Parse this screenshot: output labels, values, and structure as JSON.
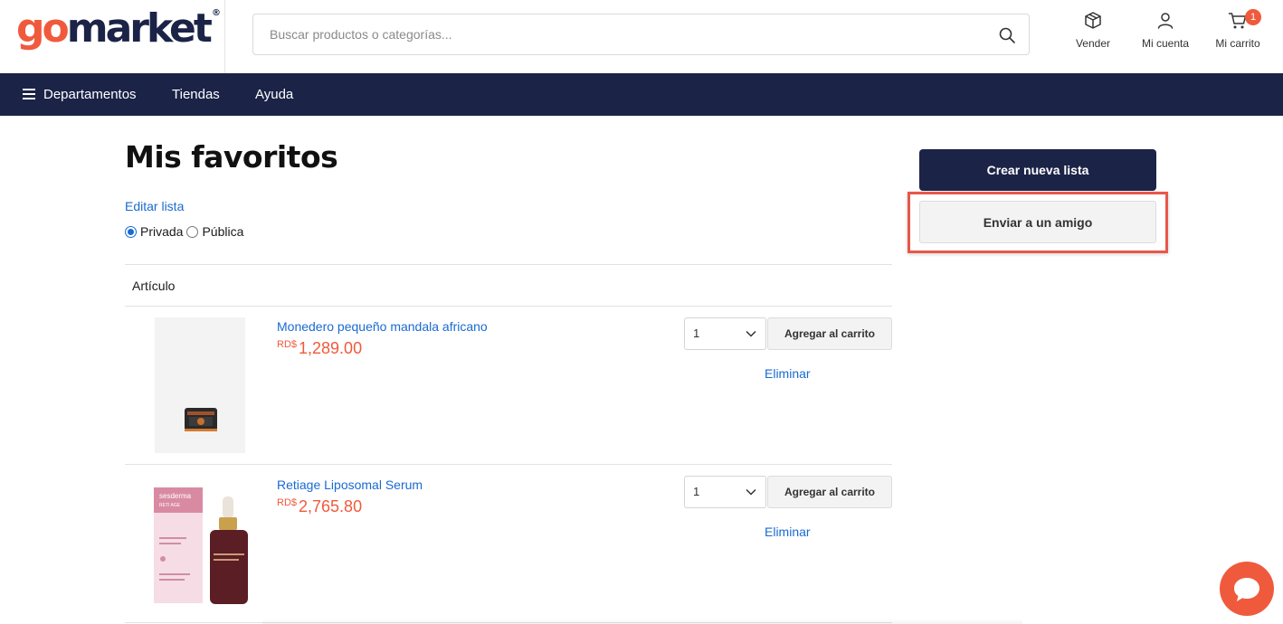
{
  "header": {
    "logo_go": "go",
    "logo_market": "market",
    "logo_reg": "®",
    "search_placeholder": "Buscar productos o categorías...",
    "links": [
      {
        "label": "Vender",
        "icon": "box-icon"
      },
      {
        "label": "Mi cuenta",
        "icon": "user-icon"
      },
      {
        "label": "Mi carrito",
        "icon": "cart-icon",
        "badge": "1"
      }
    ]
  },
  "nav": {
    "items": [
      "Departamentos",
      "Tiendas",
      "Ayuda"
    ]
  },
  "page": {
    "title": "Mis favoritos",
    "edit_link": "Editar lista",
    "privacy": {
      "private": "Privada",
      "public": "Pública",
      "selected": "Privada"
    },
    "column_header": "Artículo"
  },
  "items": [
    {
      "name": "Monedero pequeño mandala africano",
      "currency": "RD$",
      "price": "1,289.00",
      "qty": "1",
      "add_label": "Agregar al carrito",
      "delete_label": "Eliminar"
    },
    {
      "name": "Retiage Liposomal Serum",
      "currency": "RD$",
      "price": "2,765.80",
      "qty": "1",
      "add_label": "Agregar al carrito",
      "delete_label": "Eliminar",
      "image_text": {
        "brand": "sesderma",
        "line": "RETI AGE"
      }
    }
  ],
  "sidebar": {
    "create_label": "Crear nueva lista",
    "send_label": "Enviar a un amigo"
  },
  "colors": {
    "brand_orange": "#f05a3c",
    "navy": "#1b2347",
    "link_blue": "#1a6ad1",
    "highlight_red": "#e8574a"
  }
}
